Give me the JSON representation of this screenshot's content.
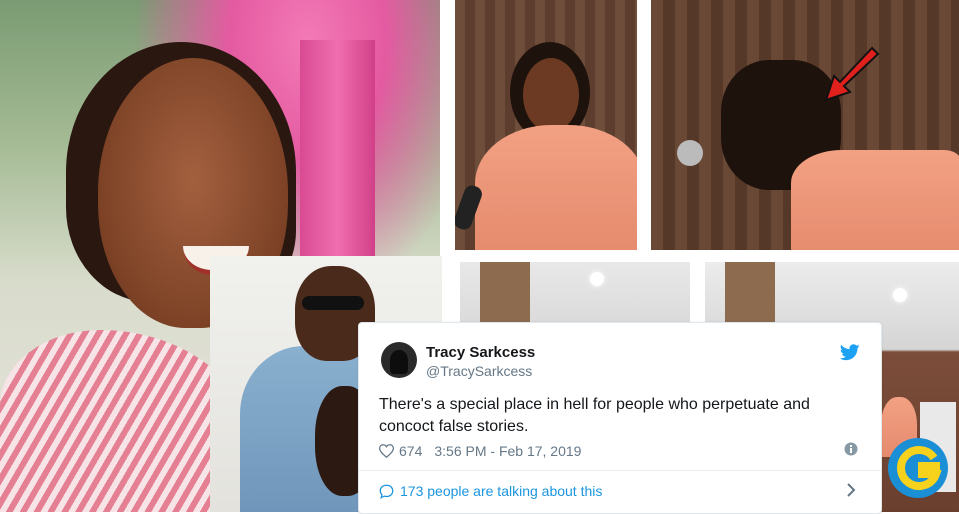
{
  "tweet": {
    "display_name": "Tracy Sarkcess",
    "handle": "@TracySarkcess",
    "text": "There's a special place in hell for people who perpetuate and concoct false stories.",
    "likes": "674",
    "timestamp": "3:56 PM - Feb 17, 2019",
    "talking": "173 people are talking about this",
    "icons": [
      "heart-icon",
      "info-icon",
      "twitter-bird-icon",
      "speech-bubble-icon",
      "chevron-right-icon"
    ],
    "colors": {
      "link": "#1b95e0",
      "muted": "#657786",
      "text": "#14171a"
    }
  },
  "overlay": {
    "arrow_color": "#e0201c"
  }
}
